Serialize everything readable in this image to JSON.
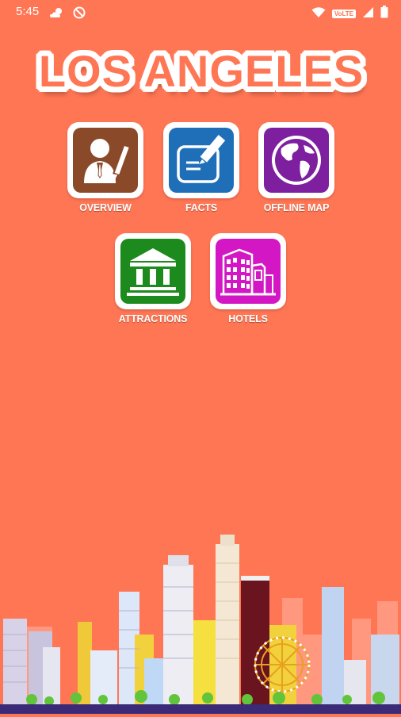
{
  "status_bar": {
    "time": "5:45",
    "left_icons": [
      "cloud-sun-icon",
      "data-saver-icon"
    ],
    "right_icons": [
      "wifi-icon",
      "volte-icon",
      "signal-icon",
      "battery-icon"
    ],
    "volte_label": "VoLTE"
  },
  "app": {
    "title": "LOS ANGELES",
    "background_color": "#FF7654"
  },
  "menu": {
    "items": [
      {
        "label": "OVERVIEW",
        "icon": "person-pencil-icon",
        "color": "#8A4A2A"
      },
      {
        "label": "FACTS",
        "icon": "note-edit-icon",
        "color": "#1E6FB8"
      },
      {
        "label": "OFFLINE MAP",
        "icon": "globe-icon",
        "color": "#7E1FA0"
      },
      {
        "label": "ATTRACTIONS",
        "icon": "museum-icon",
        "color": "#1C8A1C"
      },
      {
        "label": "HOTELS",
        "icon": "hotel-building-icon",
        "color": "#D417C4"
      }
    ]
  },
  "footer": {
    "illustration": "city-skyline"
  }
}
